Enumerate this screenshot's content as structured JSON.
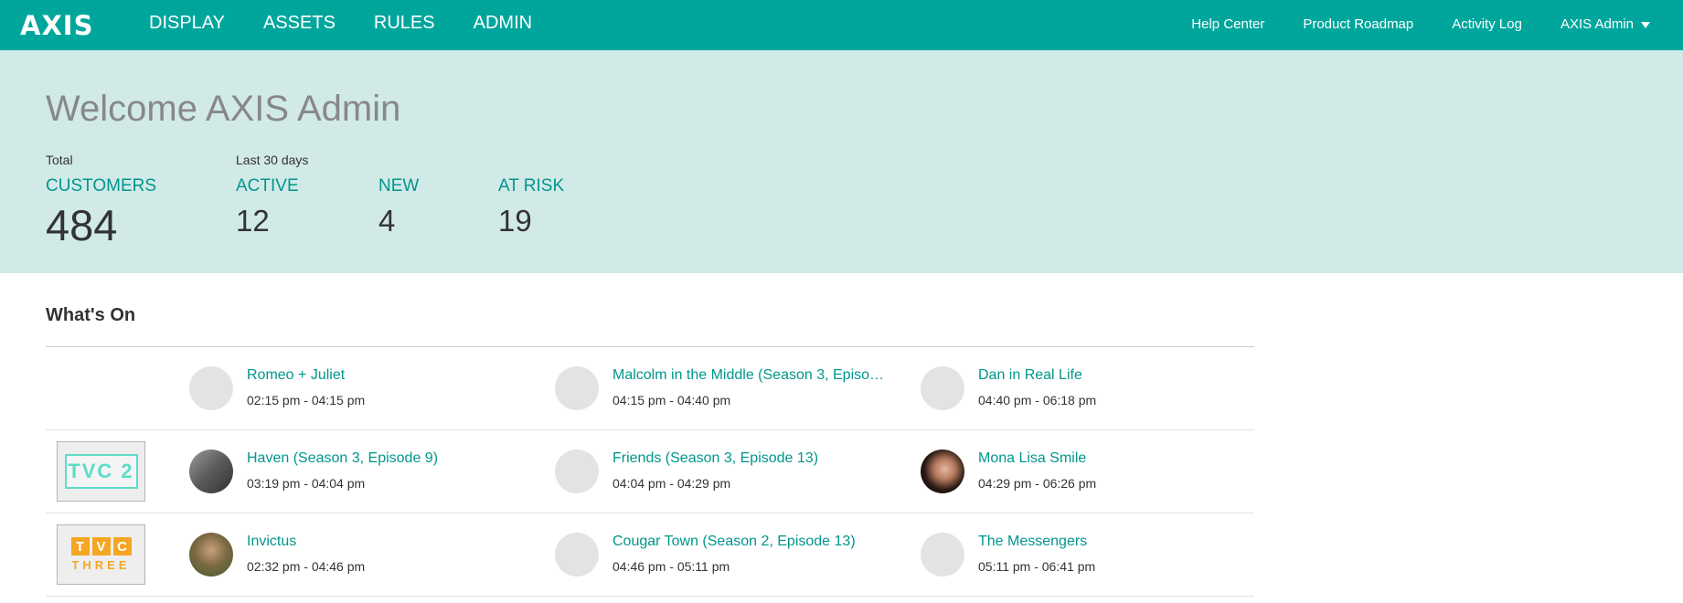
{
  "topbar": {
    "logo": "AXIS",
    "nav": [
      "DISPLAY",
      "ASSETS",
      "RULES",
      "ADMIN"
    ],
    "help_center": "Help Center",
    "roadmap": "Product Roadmap",
    "activity_log": "Activity Log",
    "user": "AXIS Admin",
    "colors": {
      "bar": "#00a69c",
      "hero": "#d1eae8",
      "accent": "#00968c"
    }
  },
  "hero": {
    "welcome": "Welcome AXIS Admin",
    "total_caption": "Total",
    "last30_caption": "Last 30 days",
    "customers": {
      "label": "CUSTOMERS",
      "value": "484"
    },
    "active": {
      "label": "ACTIVE",
      "value": "12"
    },
    "new": {
      "label": "NEW",
      "value": "4"
    },
    "at_risk": {
      "label": "AT RISK",
      "value": "19"
    }
  },
  "whats_on": {
    "title": "What's On",
    "rows": [
      {
        "channel": "",
        "programs": [
          {
            "title": "Romeo + Juliet",
            "time": "02:15 pm - 04:15 pm",
            "thumb": "placeholder"
          },
          {
            "title": "Malcolm in the Middle (Season 3, Episo…",
            "time": "04:15 pm - 04:40 pm",
            "thumb": "placeholder"
          },
          {
            "title": "Dan in Real Life",
            "time": "04:40 pm - 06:18 pm",
            "thumb": "placeholder"
          }
        ]
      },
      {
        "channel": "TVC 2",
        "programs": [
          {
            "title": "Haven (Season 3, Episode 9)",
            "time": "03:19 pm - 04:04 pm",
            "thumb": "haven"
          },
          {
            "title": "Friends (Season 3, Episode 13)",
            "time": "04:04 pm - 04:29 pm",
            "thumb": "placeholder"
          },
          {
            "title": "Mona Lisa Smile",
            "time": "04:29 pm - 06:26 pm",
            "thumb": "mona"
          }
        ]
      },
      {
        "channel": "TVC THREE",
        "programs": [
          {
            "title": "Invictus",
            "time": "02:32 pm - 04:46 pm",
            "thumb": "invictus"
          },
          {
            "title": "Cougar Town (Season 2, Episode 13)",
            "time": "04:46 pm - 05:11 pm",
            "thumb": "placeholder"
          },
          {
            "title": "The Messengers",
            "time": "05:11 pm - 06:41 pm",
            "thumb": "placeholder"
          }
        ]
      }
    ]
  }
}
